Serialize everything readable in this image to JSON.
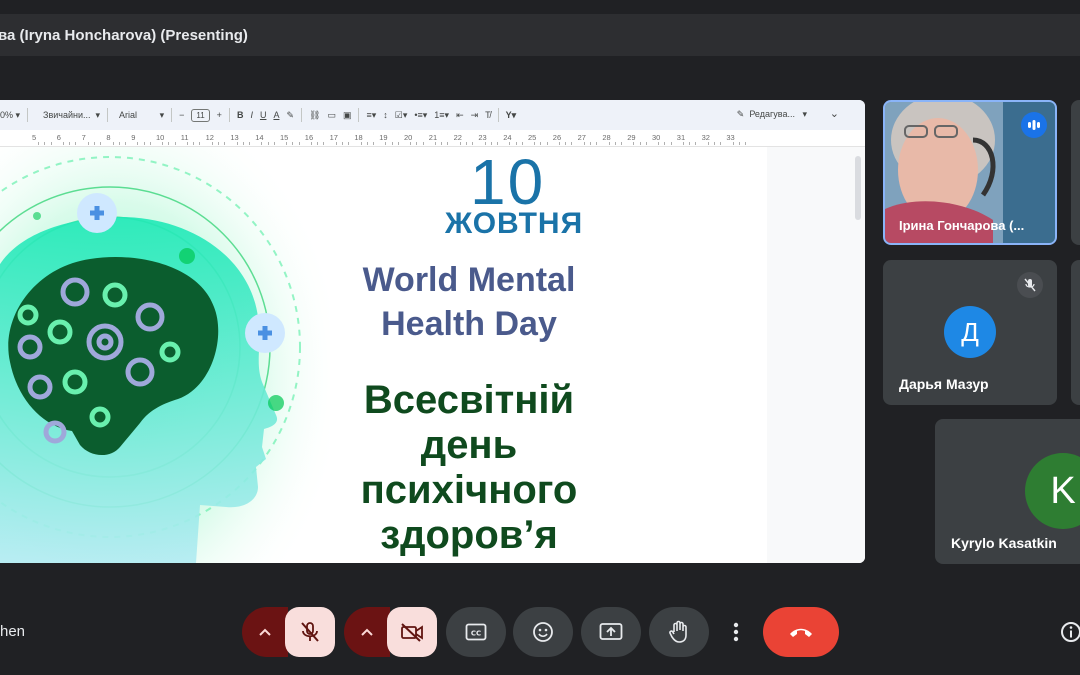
{
  "meeting": {
    "presenting_title": "ва (Iryna Honcharova) (Presenting)",
    "bottom_left_text": "hen"
  },
  "toolbar": {
    "zoom": "0%",
    "style": "Звичайни...",
    "font": "Arial",
    "font_size": "11",
    "mode": "Редагува..."
  },
  "ruler": {
    "numbers": [
      "5",
      "6",
      "7",
      "8",
      "9",
      "10",
      "11",
      "12",
      "13",
      "14",
      "15",
      "16",
      "17",
      "18",
      "19",
      "20",
      "21",
      "22",
      "23",
      "24",
      "25",
      "26",
      "27",
      "28",
      "29",
      "30",
      "31",
      "32",
      "33"
    ]
  },
  "slide": {
    "date_number": "10",
    "date_month": "ЖОВТНЯ",
    "title_en_line1": "World Mental",
    "title_en_line2": "Health Day",
    "title_uk_line1": "Всесвітній",
    "title_uk_line2": "день",
    "title_uk_line3": "психічного",
    "title_uk_line4": "здоров’я"
  },
  "participants": [
    {
      "name": "Ірина Гончарова (...",
      "status": "speaking"
    },
    {
      "name": "Дарья Мазур",
      "initial": "Д",
      "avatar_color": "#1e88e5",
      "status": "muted"
    },
    {
      "name": "Kyrylo Kasatkin",
      "initial": "K",
      "avatar_color": "#2e7d32"
    }
  ],
  "colors": {
    "end_call": "#ea4335",
    "speaking_border": "#8ab4f8",
    "muted_control": "#f9dedc"
  }
}
